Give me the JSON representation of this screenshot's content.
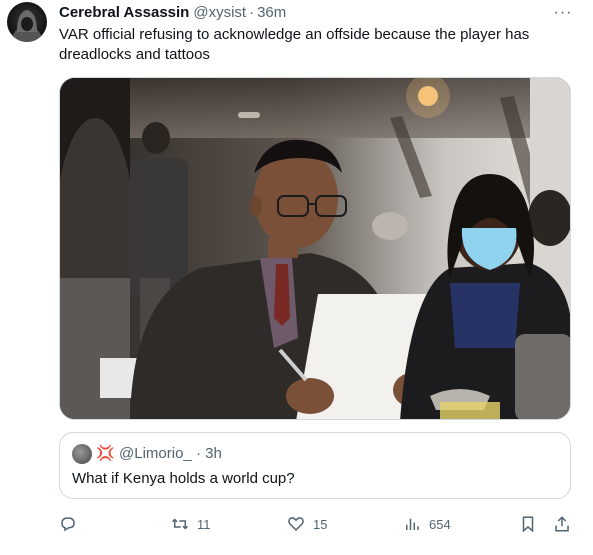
{
  "tweet": {
    "author_name": "Cerebral Assassin",
    "handle": "@xysist",
    "separator": "·",
    "time": "36m",
    "more_label": "···",
    "text": "VAR official refusing to acknowledge an offside because the player has dreadlocks and tattoos",
    "media": {
      "icon": "photo"
    }
  },
  "quote": {
    "handle": "@Limorio_",
    "separator": "·",
    "time": "3h",
    "badge_icon": "anger-symbol-icon",
    "text": "What if Kenya holds a world cup?"
  },
  "actions": {
    "reply": {
      "icon": "reply-icon",
      "count": ""
    },
    "retweet": {
      "icon": "retweet-icon",
      "count": "11"
    },
    "like": {
      "icon": "heart-icon",
      "count": "15"
    },
    "views": {
      "icon": "views-icon",
      "count": "654"
    },
    "bookmark": {
      "icon": "bookmark-icon"
    },
    "share": {
      "icon": "share-icon"
    }
  },
  "colors": {
    "text_primary": "#0f1419",
    "text_secondary": "#536471",
    "border": "#cfd9de",
    "badge": "#e0245e"
  }
}
